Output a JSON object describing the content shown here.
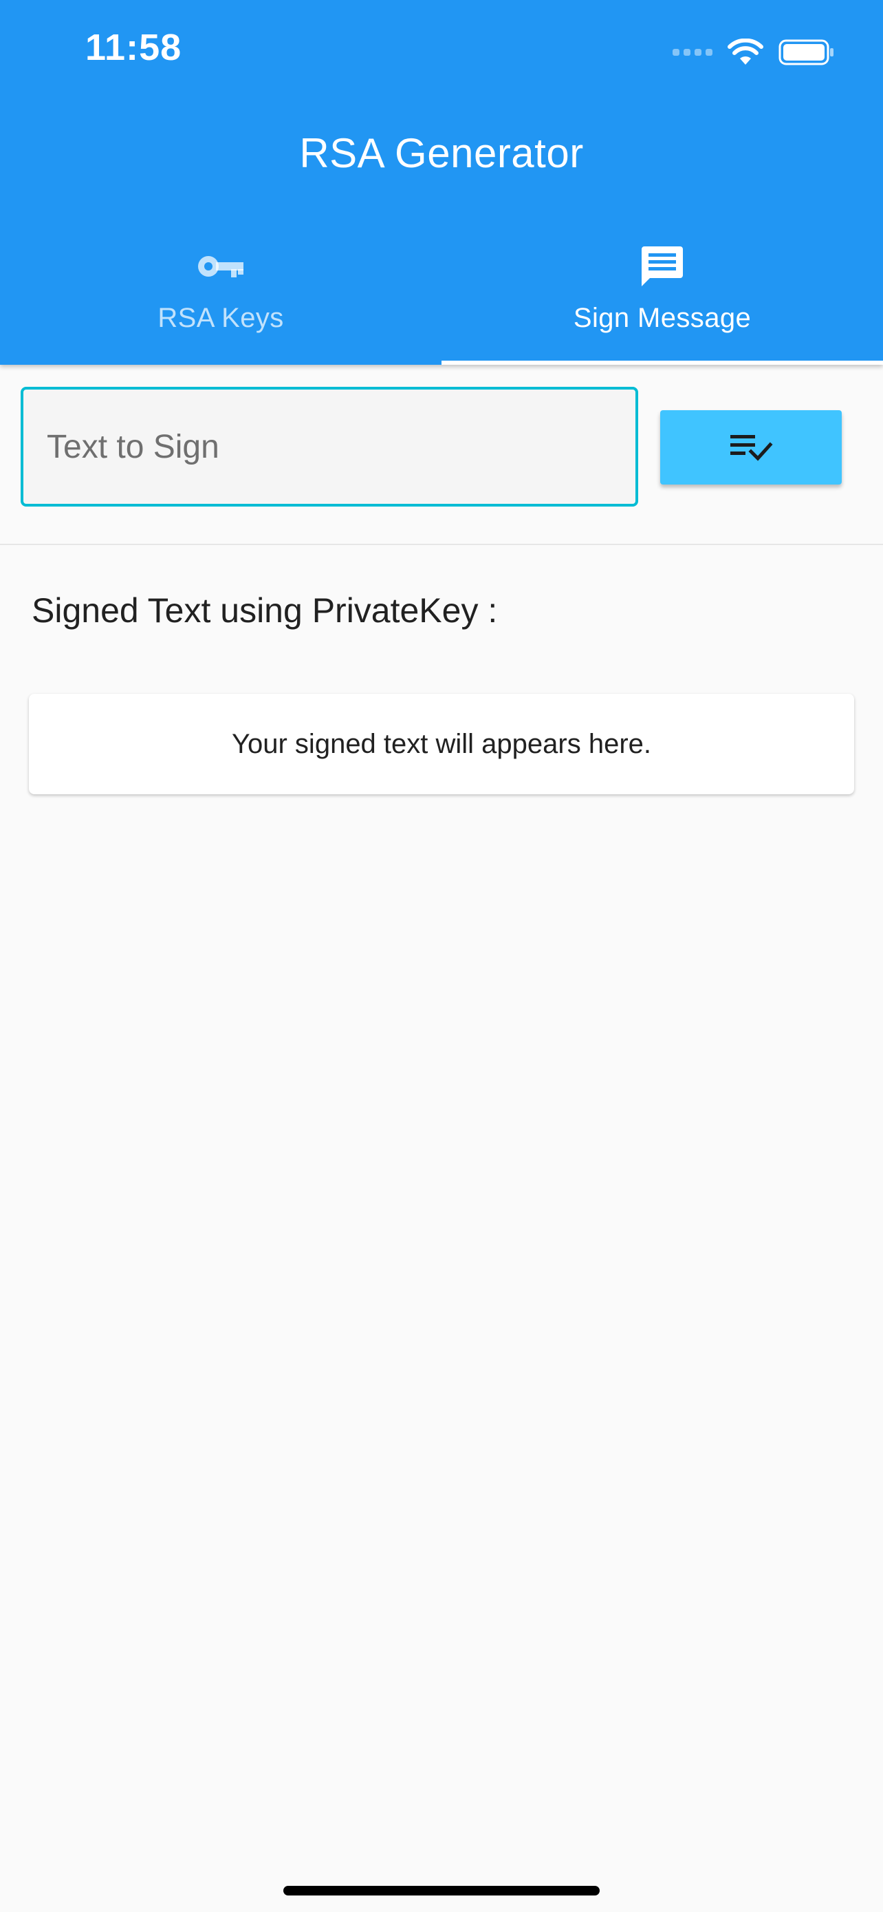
{
  "status_bar": {
    "time": "11:58"
  },
  "app_bar": {
    "title": "RSA Generator"
  },
  "tabs": [
    {
      "label": "RSA Keys",
      "icon": "key-icon",
      "active": false
    },
    {
      "label": "Sign Message",
      "icon": "message-icon",
      "active": true
    }
  ],
  "sign_form": {
    "input_placeholder": "Text to Sign",
    "input_value": "",
    "button_icon": "playlist-add-check-icon"
  },
  "result": {
    "label": "Signed Text using PrivateKey :",
    "placeholder_text": "Your signed text will appears here."
  },
  "colors": {
    "primary": "#2196f3",
    "accent_button": "#40c4ff",
    "input_border": "#00bcd4",
    "background": "#fafafa"
  }
}
